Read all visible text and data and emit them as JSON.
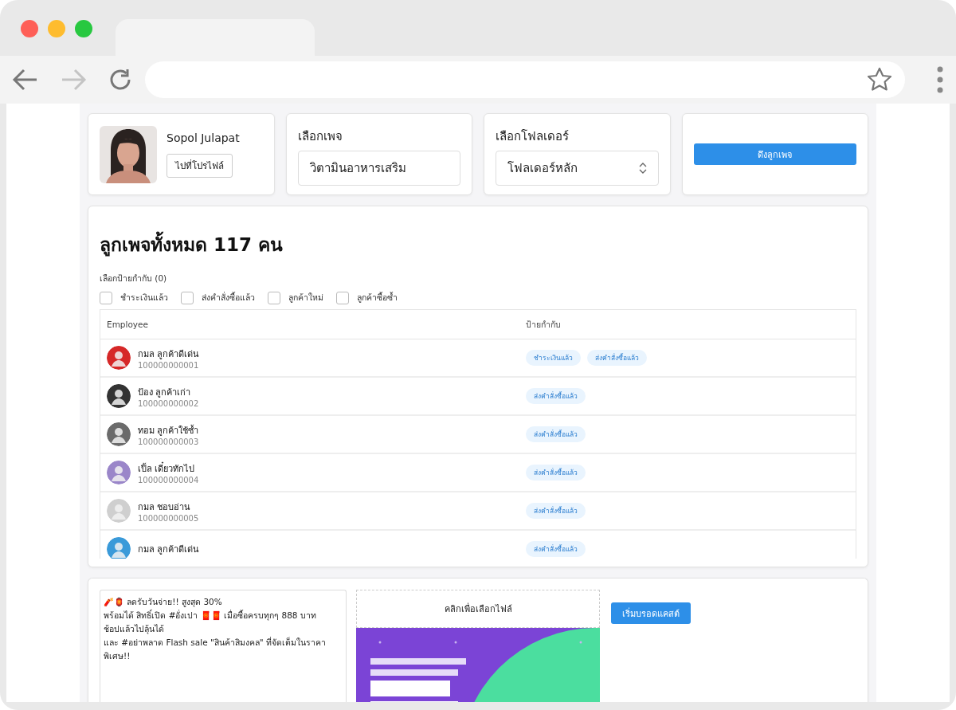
{
  "profile": {
    "name": "Sopol Julapat",
    "button": "ไปที่โปรไฟล์"
  },
  "page_select": {
    "label": "เลือกเพจ",
    "value": "วิตามินอาหารเสริม"
  },
  "folder_select": {
    "label": "เลือกโฟลเดอร์",
    "value": "โฟลเดอร์หลัก"
  },
  "fetch_button": "ดึงลูกเพจ",
  "title": "ลูกเพจทั้งหมด 117 คน",
  "tag_filter": {
    "label": "เลือกป้ายกำกับ (0)",
    "options": [
      {
        "label": "ชำระเงินแล้ว",
        "checked": false
      },
      {
        "label": "ส่งคำสั่งซื้อแล้ว",
        "checked": false
      },
      {
        "label": "ลูกค้าใหม่",
        "checked": false
      },
      {
        "label": "ลูกค้าซื้อซ้ำ",
        "checked": false
      }
    ]
  },
  "table": {
    "columns": [
      "Employee",
      "ป้ายกำกับ"
    ],
    "rows": [
      {
        "name": "กมล ลูกค้าดีเด่น",
        "id": "100000000001",
        "tags": [
          "ชำระเงินแล้ว",
          "ส่งคำสั่งซื้อแล้ว"
        ],
        "color": "#d62828"
      },
      {
        "name": "ป้อง ลูกค้าเก่า",
        "id": "100000000002",
        "tags": [
          "ส่งคำสั่งซื้อแล้ว"
        ],
        "color": "#333333"
      },
      {
        "name": "ทอม ลูกค้าใช้ซ้ำ",
        "id": "100000000003",
        "tags": [
          "ส่งคำสั่งซื้อแล้ว"
        ],
        "color": "#6b6b6b"
      },
      {
        "name": "เปิ้ล เดี๋ยวทักไป",
        "id": "100000000004",
        "tags": [
          "ส่งคำสั่งซื้อแล้ว"
        ],
        "color": "#9a86c9"
      },
      {
        "name": "กมล ชอบอ่าน",
        "id": "100000000005",
        "tags": [
          "ส่งคำสั่งซื้อแล้ว"
        ],
        "color": "#cfcfcf"
      },
      {
        "name": "กมล ลูกค้าดีเด่น",
        "tags": [
          "ส่งคำสั่งซื้อแล้ว"
        ],
        "color": "#3a9ad9"
      }
    ]
  },
  "broadcast": {
    "message": [
      "🧨🏮 ลดรับวันจ่าย!! สูงสุด 30%",
      "พร้อมได้ สิทธิ์เปิด #อั่งเปา 🧧🧧 เมื่อซื้อครบทุกๆ 888 บาท",
      "ช้อปแล้วไปลุ้นได้",
      "และ #อย่าพลาด Flash sale \"สินค้าสิมงคล\" ที่จัดเต็มในราคาพิเศษ!!"
    ],
    "upload_label": "คลิกเพื่อเลือกไฟล์",
    "button": "เริ่มบรอดแคสต์"
  }
}
